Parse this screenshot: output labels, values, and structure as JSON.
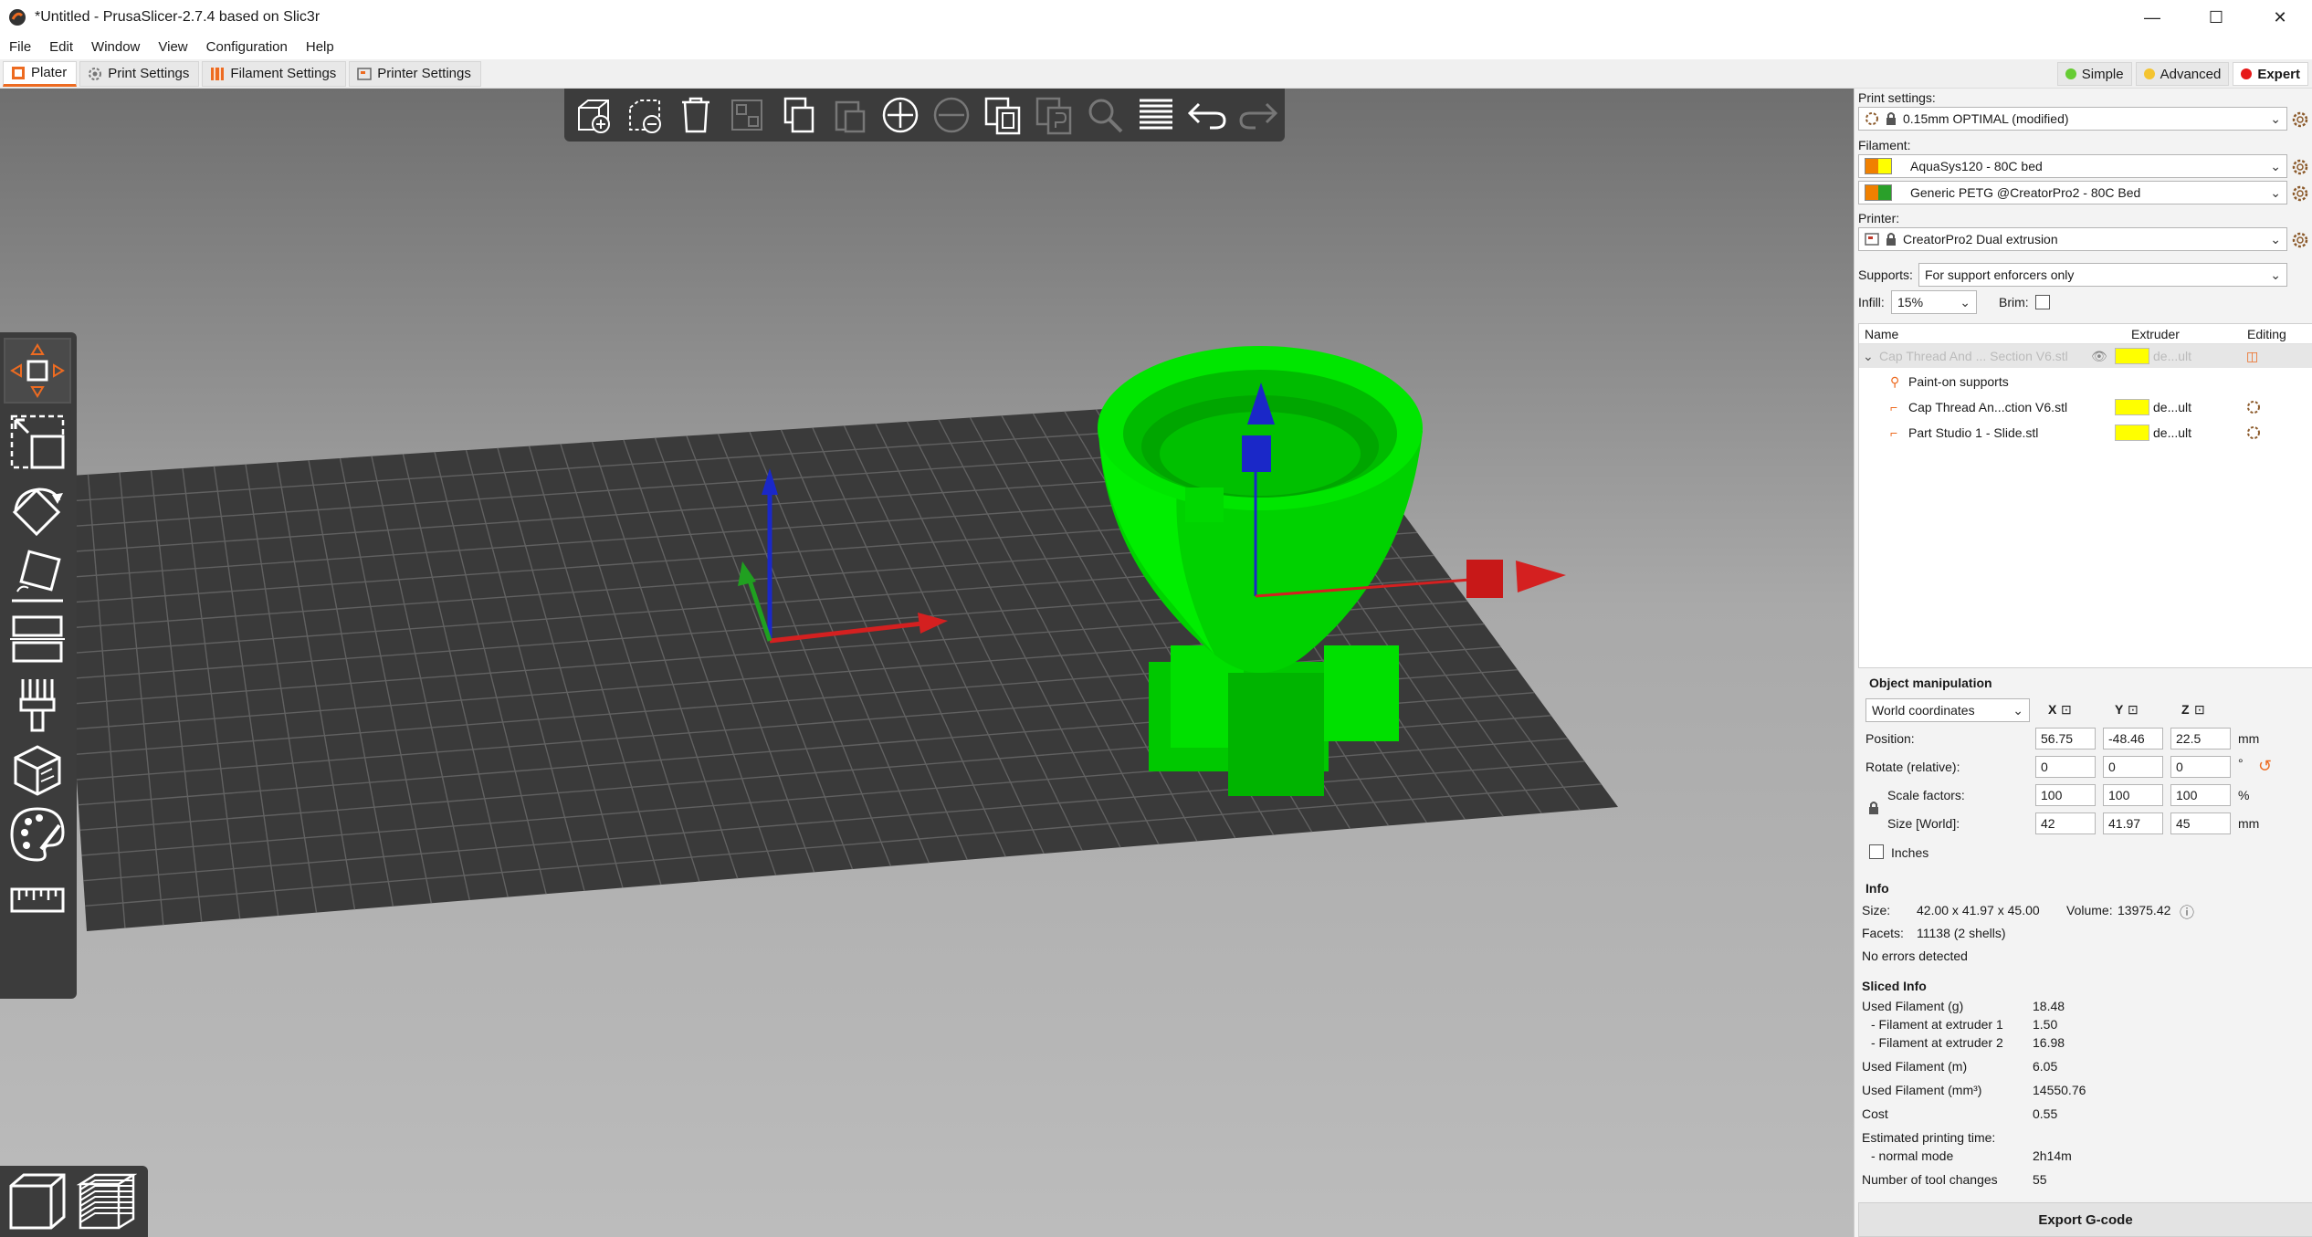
{
  "window": {
    "title": "*Untitled - PrusaSlicer-2.7.4 based on Slic3r",
    "controls": [
      "—",
      "☐",
      "✕"
    ]
  },
  "menu": [
    "File",
    "Edit",
    "Window",
    "View",
    "Configuration",
    "Help"
  ],
  "tabs": [
    {
      "label": "Plater",
      "icon": "plater-icon"
    },
    {
      "label": "Print Settings",
      "icon": "gear-icon"
    },
    {
      "label": "Filament Settings",
      "icon": "spool-icon"
    },
    {
      "label": "Printer Settings",
      "icon": "printer-icon"
    }
  ],
  "modes": [
    {
      "label": "Simple",
      "color": "#66cc33"
    },
    {
      "label": "Advanced",
      "color": "#f4c430"
    },
    {
      "label": "Expert",
      "color": "#e61919"
    }
  ],
  "sidebar": {
    "print_settings_label": "Print settings:",
    "print_preset": "0.15mm OPTIMAL (modified)",
    "filament_label": "Filament:",
    "filaments": [
      {
        "name": "AquaSys120 - 80C bed",
        "colors": [
          "#f08000",
          "#ffff00"
        ]
      },
      {
        "name": "Generic PETG @CreatorPro2 - 80C Bed",
        "colors": [
          "#f08000",
          "#2aa02a"
        ]
      }
    ],
    "printer_label": "Printer:",
    "printer_preset": "CreatorPro2 Dual extrusion",
    "supports_label": "Supports:",
    "supports_value": "For support enforcers only",
    "infill_label": "Infill:",
    "infill_value": "15%",
    "brim_label": "Brim:"
  },
  "object_list": {
    "headers": {
      "name": "Name",
      "extruder": "Extruder",
      "editing": "Editing"
    },
    "rows": [
      {
        "name": "Cap Thread And ... Section V6.stl",
        "extruder": "de...ult"
      },
      {
        "name": "Paint-on supports",
        "extruder": ""
      },
      {
        "name": "Cap Thread An...ction V6.stl",
        "extruder": "de...ult"
      },
      {
        "name": "Part Studio 1 - Slide.stl",
        "extruder": "de...ult"
      }
    ]
  },
  "object_manipulation": {
    "title": "Object manipulation",
    "coord_system": "World coordinates",
    "axes": [
      "X",
      "Y",
      "Z"
    ],
    "position_label": "Position:",
    "position": [
      "56.75",
      "-48.46",
      "22.5"
    ],
    "position_unit": "mm",
    "rotate_label": "Rotate (relative):",
    "rotate": [
      "0",
      "0",
      "0"
    ],
    "rotate_unit": "°",
    "scale_label": "Scale factors:",
    "scale": [
      "100",
      "100",
      "100"
    ],
    "scale_unit": "%",
    "size_label": "Size [World]:",
    "size": [
      "42",
      "41.97",
      "45"
    ],
    "size_unit": "mm",
    "inches_label": "Inches"
  },
  "info": {
    "title": "Info",
    "size_label": "Size:",
    "size_value": "42.00 x 41.97 x 45.00",
    "volume_label": "Volume:",
    "volume_value": "13975.42",
    "facets_label": "Facets:",
    "facets_value": "11138 (2 shells)",
    "errors": "No errors detected"
  },
  "sliced_info": {
    "title": "Sliced Info",
    "rows": [
      {
        "label": "Used Filament (g)",
        "value": "18.48"
      },
      {
        "label": "- Filament at extruder 1",
        "value": "1.50"
      },
      {
        "label": "- Filament at extruder 2",
        "value": "16.98"
      },
      {
        "label": "Used Filament (m)",
        "value": "6.05"
      },
      {
        "label": "Used Filament (mm³)",
        "value": "14550.76"
      },
      {
        "label": "Cost",
        "value": "0.55"
      },
      {
        "label": "Estimated printing time:",
        "value": ""
      },
      {
        "label": "- normal mode",
        "value": "2h14m"
      },
      {
        "label": "Number of tool changes",
        "value": "55"
      }
    ]
  },
  "export_label": "Export G-code",
  "colors": {
    "accent": "#ed6b21",
    "model": "#00e000",
    "bed": "#3a3a3a"
  }
}
